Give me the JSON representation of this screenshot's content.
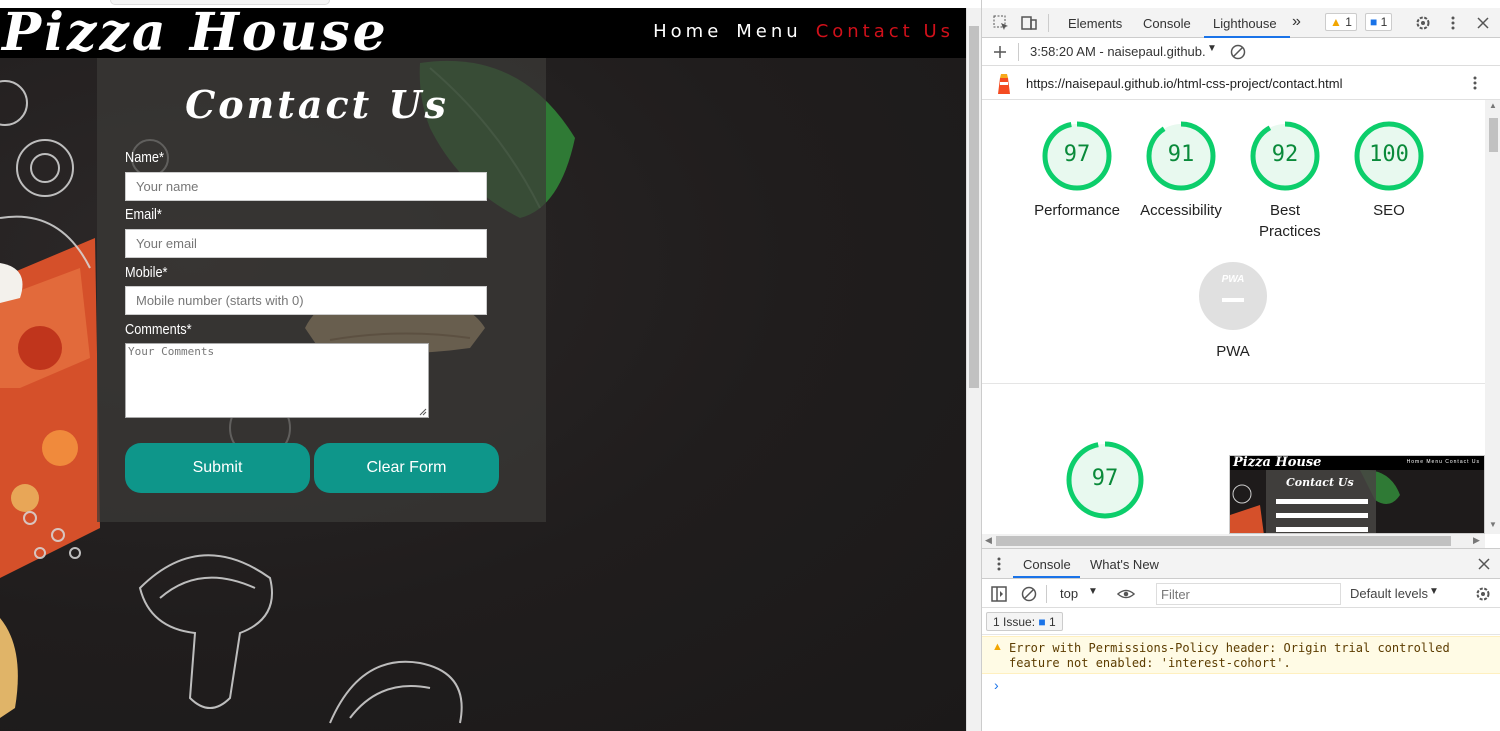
{
  "site": {
    "brand": "Pizza House",
    "nav": [
      {
        "label": "Home"
      },
      {
        "label": "Menu"
      },
      {
        "label": "Contact Us"
      }
    ],
    "form": {
      "title": "Contact Us",
      "name_label": "Name*",
      "name_placeholder": "Your name",
      "email_label": "Email*",
      "email_placeholder": "Your email",
      "mobile_label": "Mobile*",
      "mobile_placeholder": "Mobile number (starts with 0)",
      "comments_label": "Comments*",
      "comments_placeholder": "Your Comments",
      "submit_label": "Submit",
      "clear_label": "Clear Form"
    },
    "accent_color": "#0e968a",
    "active_nav_color": "#d0101a"
  },
  "devtools": {
    "tabs": {
      "elements": "Elements",
      "console": "Console",
      "lighthouse": "Lighthouse",
      "more": "»"
    },
    "warnings_count": "1",
    "messages_count": "1",
    "report_select": "3:58:20 AM - naisepaul.github.",
    "report_url": "https://naisepaul.github.io/html-css-project/contact.html",
    "scores": [
      {
        "value": "97",
        "label": "Performance"
      },
      {
        "value": "91",
        "label": "Accessibility"
      },
      {
        "value": "92",
        "label": "Best Practices"
      },
      {
        "value": "100",
        "label": "SEO"
      }
    ],
    "pwa": {
      "badge": "PWA",
      "label": "PWA"
    },
    "perf_score": "97",
    "thumbnail": {
      "brand": "Pizza House",
      "nav": "Home Menu Contact Us",
      "title": "Contact Us"
    },
    "drawer": {
      "tab_console": "Console",
      "tab_whats_new": "What's New",
      "context": "top",
      "filter_placeholder": "Filter",
      "levels": "Default levels",
      "issues_label": "1 Issue:",
      "issues_count": "1",
      "warning_text": "Error with Permissions-Policy header: Origin trial controlled feature not enabled: 'interest-cohort'.",
      "prompt": "›"
    },
    "score_color": "#0cce6b",
    "score_text_color": "#0a8a3a",
    "warning_color": "#f2a600"
  }
}
